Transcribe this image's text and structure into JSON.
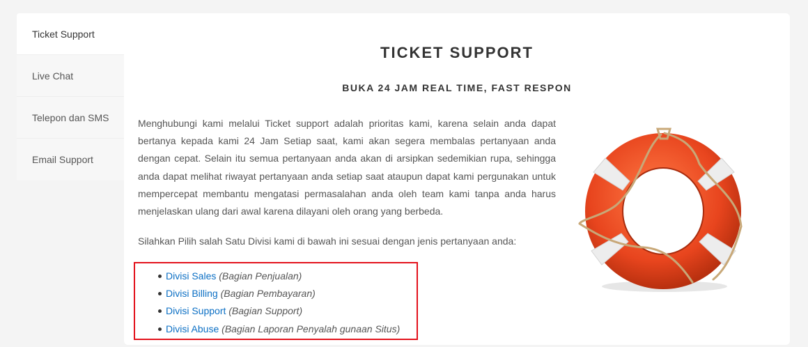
{
  "sidebar": {
    "items": [
      {
        "label": "Ticket Support",
        "active": true
      },
      {
        "label": "Live Chat",
        "active": false
      },
      {
        "label": "Telepon dan SMS",
        "active": false
      },
      {
        "label": "Email Support",
        "active": false
      }
    ]
  },
  "main": {
    "title": "TICKET SUPPORT",
    "subtitle": "BUKA 24 JAM REAL TIME, FAST RESPON",
    "intro": "Menghubungi kami melalui Ticket support adalah prioritas kami, karena selain anda dapat bertanya kepada kami 24 Jam Setiap saat, kami akan segera membalas pertanyaan anda dengan cepat. Selain itu semua pertanyaan anda akan di arsipkan sedemikian rupa, sehingga anda dapat melihat riwayat pertanyaan anda setiap saat ataupun dapat kami pergunakan untuk mempercepat membantu mengatasi permasalahan anda oleh team kami tanpa anda harus menjelaskan ulang dari awal karena dilayani oleh orang yang berbeda.",
    "prompt": "Silahkan Pilih salah Satu Divisi kami di bawah ini sesuai dengan jenis pertanyaan anda:",
    "divisions": [
      {
        "link": "Divisi Sales",
        "note": "(Bagian Penjualan)"
      },
      {
        "link": "Divisi Billing",
        "note": "(Bagian Pembayaran)"
      },
      {
        "link": "Divisi Support",
        "note": "(Bagian Support)"
      },
      {
        "link": "Divisi Abuse",
        "note": "(Bagian Laporan Penyalah gunaan Situs)"
      }
    ],
    "image_icon": "lifebuoy-icon"
  },
  "colors": {
    "link": "#0b6fc4",
    "highlight_border": "#e3111b",
    "lifebuoy_orange": "#e8451e",
    "lifebuoy_white": "#ededed",
    "rope": "#c8a878"
  }
}
